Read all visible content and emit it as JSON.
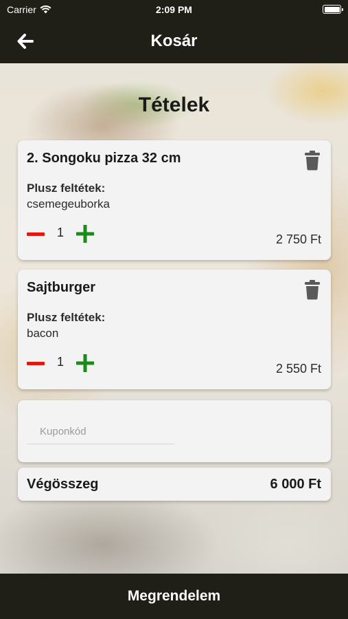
{
  "status_bar": {
    "carrier": "Carrier",
    "time": "2:09 PM"
  },
  "nav": {
    "title": "Kosár",
    "back_icon": "arrow-left-icon"
  },
  "section_title": "Tételek",
  "items": [
    {
      "name": "2. Songoku pizza 32 cm",
      "extras_label": "Plusz feltétek:",
      "extras": "csemegeuborka",
      "quantity": "1",
      "price": "2 750 Ft"
    },
    {
      "name": "Sajtburger",
      "extras_label": "Plusz feltétek:",
      "extras": "bacon",
      "quantity": "1",
      "price": "2 550 Ft"
    }
  ],
  "coupon": {
    "placeholder": "Kuponkód",
    "value": ""
  },
  "total": {
    "label": "Végösszeg",
    "value": "6 000 Ft"
  },
  "order_button": {
    "label": "Megrendelem"
  },
  "colors": {
    "bar": "#1f1f17",
    "minus": "#e3170a",
    "plus": "#1a8a1a",
    "card": "#f3f3f3"
  }
}
